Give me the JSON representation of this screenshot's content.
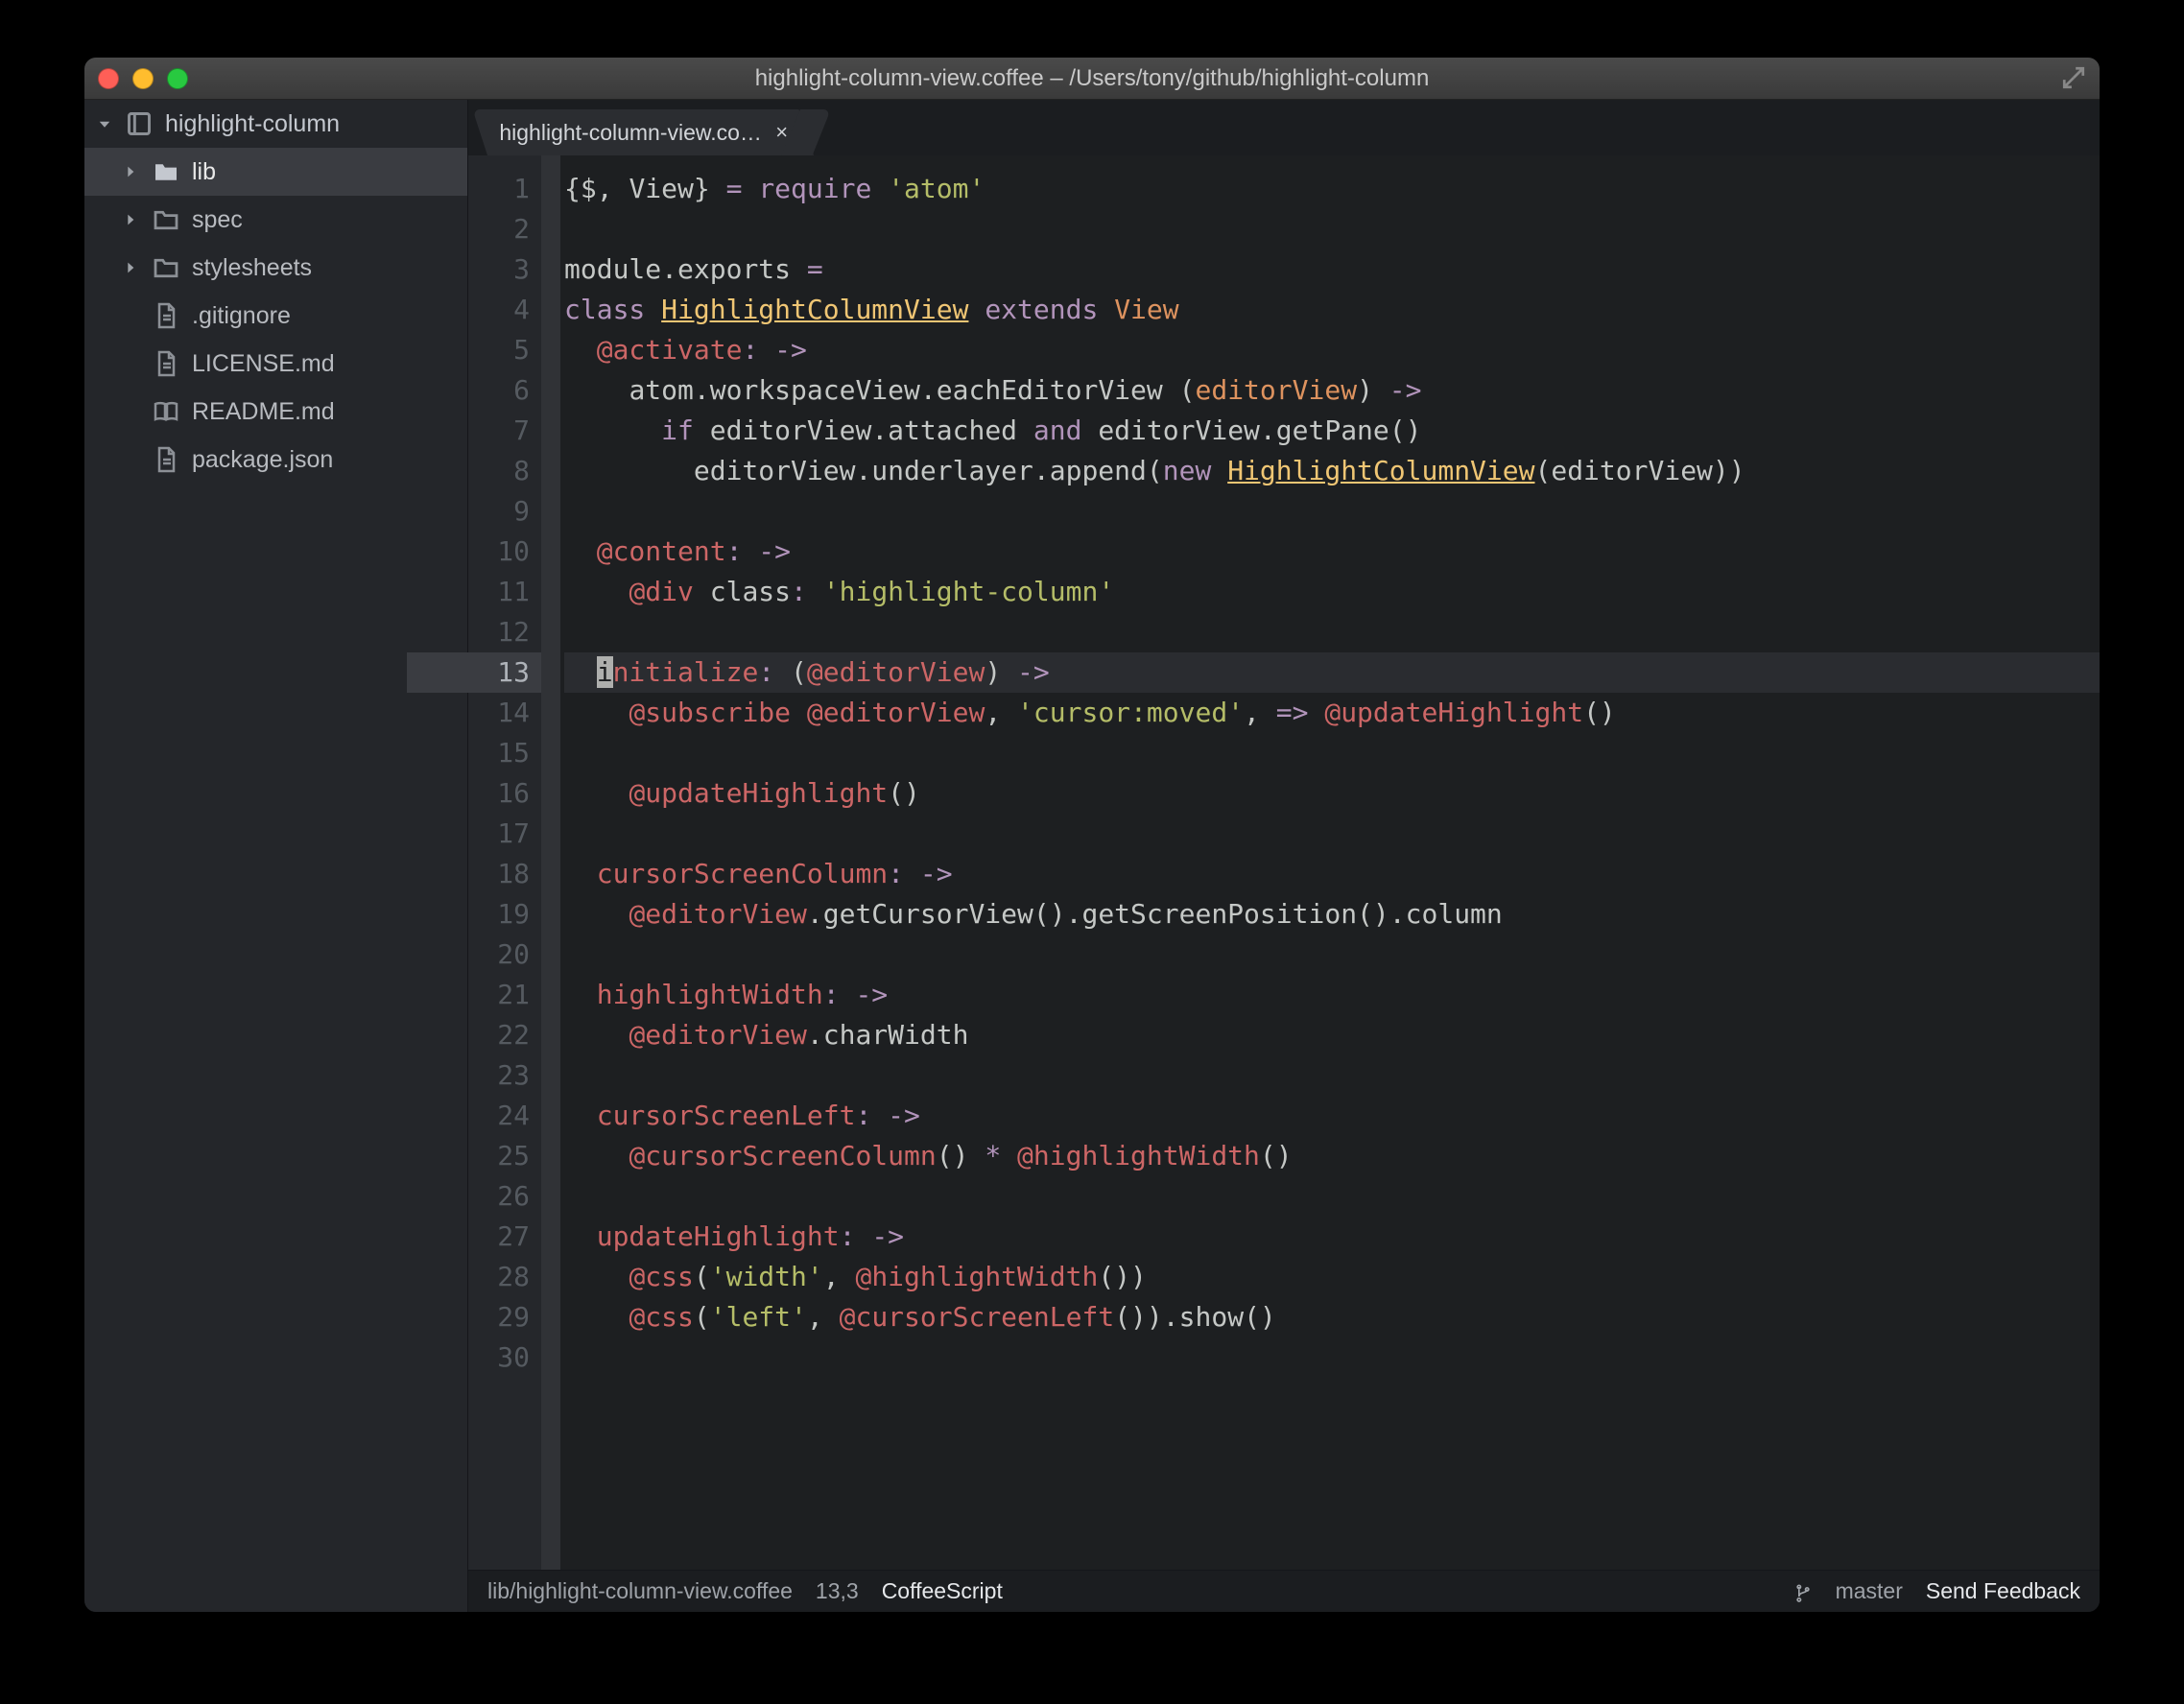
{
  "window": {
    "title": "highlight-column-view.coffee – /Users/tony/github/highlight-column"
  },
  "sidebar": {
    "project": "highlight-column",
    "items": [
      {
        "type": "folder",
        "label": "lib",
        "selected": true
      },
      {
        "type": "folder-outline",
        "label": "spec"
      },
      {
        "type": "folder-outline",
        "label": "stylesheets"
      },
      {
        "type": "file",
        "label": ".gitignore"
      },
      {
        "type": "file",
        "label": "LICENSE.md"
      },
      {
        "type": "book",
        "label": "README.md"
      },
      {
        "type": "file",
        "label": "package.json"
      }
    ]
  },
  "tab": {
    "label": "highlight-column-view.co…"
  },
  "editor": {
    "cursor_line_index": 12,
    "lines": [
      [
        [
          "c-punc",
          "{"
        ],
        [
          "c-ident",
          "$"
        ],
        [
          "c-punc",
          ", "
        ],
        [
          "c-ident",
          "View"
        ],
        [
          "c-punc",
          "} "
        ],
        [
          "c-kw",
          "="
        ],
        [
          "c-punc",
          " "
        ],
        [
          "c-kw",
          "require"
        ],
        [
          "c-punc",
          " "
        ],
        [
          "c-str",
          "'atom'"
        ]
      ],
      [],
      [
        [
          "c-ident",
          "module"
        ],
        [
          "c-punc",
          "."
        ],
        [
          "c-ident",
          "exports"
        ],
        [
          "c-punc",
          " "
        ],
        [
          "c-kw",
          "="
        ]
      ],
      [
        [
          "c-kw",
          "class"
        ],
        [
          "c-punc",
          " "
        ],
        [
          "c-classU",
          "HighlightColumnView"
        ],
        [
          "c-punc",
          " "
        ],
        [
          "c-kw",
          "extends"
        ],
        [
          "c-punc",
          " "
        ],
        [
          "c-base",
          "View"
        ]
      ],
      [
        [
          "c-punc",
          "  "
        ],
        [
          "c-var",
          "@activate"
        ],
        [
          "c-kw",
          ":"
        ],
        [
          "c-punc",
          " "
        ],
        [
          "c-kw",
          "->"
        ]
      ],
      [
        [
          "c-punc",
          "    "
        ],
        [
          "c-ident",
          "atom"
        ],
        [
          "c-punc",
          "."
        ],
        [
          "c-ident",
          "workspaceView"
        ],
        [
          "c-punc",
          "."
        ],
        [
          "c-ident",
          "eachEditorView"
        ],
        [
          "c-punc",
          " "
        ],
        [
          "c-punc",
          "("
        ],
        [
          "c-base",
          "editorView"
        ],
        [
          "c-punc",
          ")"
        ],
        [
          "c-punc",
          " "
        ],
        [
          "c-kw",
          "->"
        ]
      ],
      [
        [
          "c-punc",
          "      "
        ],
        [
          "c-kw",
          "if"
        ],
        [
          "c-punc",
          " "
        ],
        [
          "c-ident",
          "editorView"
        ],
        [
          "c-punc",
          "."
        ],
        [
          "c-ident",
          "attached"
        ],
        [
          "c-punc",
          " "
        ],
        [
          "c-kw",
          "and"
        ],
        [
          "c-punc",
          " "
        ],
        [
          "c-ident",
          "editorView"
        ],
        [
          "c-punc",
          "."
        ],
        [
          "c-ident",
          "getPane"
        ],
        [
          "c-punc",
          "()"
        ]
      ],
      [
        [
          "c-punc",
          "        "
        ],
        [
          "c-ident",
          "editorView"
        ],
        [
          "c-punc",
          "."
        ],
        [
          "c-ident",
          "underlayer"
        ],
        [
          "c-punc",
          "."
        ],
        [
          "c-ident",
          "append"
        ],
        [
          "c-punc",
          "("
        ],
        [
          "c-kw",
          "new"
        ],
        [
          "c-punc",
          " "
        ],
        [
          "c-classU",
          "HighlightColumnView"
        ],
        [
          "c-punc",
          "("
        ],
        [
          "c-ident",
          "editorView"
        ],
        [
          "c-punc",
          "))"
        ]
      ],
      [],
      [
        [
          "c-punc",
          "  "
        ],
        [
          "c-var",
          "@content"
        ],
        [
          "c-kw",
          ":"
        ],
        [
          "c-punc",
          " "
        ],
        [
          "c-kw",
          "->"
        ]
      ],
      [
        [
          "c-punc",
          "    "
        ],
        [
          "c-var",
          "@div"
        ],
        [
          "c-punc",
          " "
        ],
        [
          "c-attrL",
          "class"
        ],
        [
          "c-kw",
          ":"
        ],
        [
          "c-punc",
          " "
        ],
        [
          "c-str",
          "'highlight-column'"
        ]
      ],
      [],
      [
        [
          "c-punc",
          "  "
        ],
        [
          "c-cursor",
          "i"
        ],
        [
          "c-attr",
          "nitialize"
        ],
        [
          "c-kw",
          ":"
        ],
        [
          "c-punc",
          " "
        ],
        [
          "c-punc",
          "("
        ],
        [
          "c-var",
          "@editorView"
        ],
        [
          "c-punc",
          ")"
        ],
        [
          "c-punc",
          " "
        ],
        [
          "c-kw",
          "->"
        ]
      ],
      [
        [
          "c-punc",
          "    "
        ],
        [
          "c-var",
          "@subscribe"
        ],
        [
          "c-punc",
          " "
        ],
        [
          "c-var",
          "@editorView"
        ],
        [
          "c-punc",
          ", "
        ],
        [
          "c-str",
          "'cursor:moved'"
        ],
        [
          "c-punc",
          ", "
        ],
        [
          "c-kw",
          "=>"
        ],
        [
          "c-punc",
          " "
        ],
        [
          "c-var",
          "@updateHighlight"
        ],
        [
          "c-punc",
          "()"
        ]
      ],
      [],
      [
        [
          "c-punc",
          "    "
        ],
        [
          "c-var",
          "@updateHighlight"
        ],
        [
          "c-punc",
          "()"
        ]
      ],
      [],
      [
        [
          "c-punc",
          "  "
        ],
        [
          "c-attr",
          "cursorScreenColumn"
        ],
        [
          "c-kw",
          ":"
        ],
        [
          "c-punc",
          " "
        ],
        [
          "c-kw",
          "->"
        ]
      ],
      [
        [
          "c-punc",
          "    "
        ],
        [
          "c-var",
          "@editorView"
        ],
        [
          "c-punc",
          "."
        ],
        [
          "c-ident",
          "getCursorView"
        ],
        [
          "c-punc",
          "()."
        ],
        [
          "c-ident",
          "getScreenPosition"
        ],
        [
          "c-punc",
          "()."
        ],
        [
          "c-ident",
          "column"
        ]
      ],
      [],
      [
        [
          "c-punc",
          "  "
        ],
        [
          "c-attr",
          "highlightWidth"
        ],
        [
          "c-kw",
          ":"
        ],
        [
          "c-punc",
          " "
        ],
        [
          "c-kw",
          "->"
        ]
      ],
      [
        [
          "c-punc",
          "    "
        ],
        [
          "c-var",
          "@editorView"
        ],
        [
          "c-punc",
          "."
        ],
        [
          "c-ident",
          "charWidth"
        ]
      ],
      [],
      [
        [
          "c-punc",
          "  "
        ],
        [
          "c-attr",
          "cursorScreenLeft"
        ],
        [
          "c-kw",
          ":"
        ],
        [
          "c-punc",
          " "
        ],
        [
          "c-kw",
          "->"
        ]
      ],
      [
        [
          "c-punc",
          "    "
        ],
        [
          "c-var",
          "@cursorScreenColumn"
        ],
        [
          "c-punc",
          "() "
        ],
        [
          "c-kw",
          "*"
        ],
        [
          "c-punc",
          " "
        ],
        [
          "c-var",
          "@highlightWidth"
        ],
        [
          "c-punc",
          "()"
        ]
      ],
      [],
      [
        [
          "c-punc",
          "  "
        ],
        [
          "c-attr",
          "updateHighlight"
        ],
        [
          "c-kw",
          ":"
        ],
        [
          "c-punc",
          " "
        ],
        [
          "c-kw",
          "->"
        ]
      ],
      [
        [
          "c-punc",
          "    "
        ],
        [
          "c-var",
          "@css"
        ],
        [
          "c-punc",
          "("
        ],
        [
          "c-str",
          "'width'"
        ],
        [
          "c-punc",
          ", "
        ],
        [
          "c-var",
          "@highlightWidth"
        ],
        [
          "c-punc",
          "())"
        ]
      ],
      [
        [
          "c-punc",
          "    "
        ],
        [
          "c-var",
          "@css"
        ],
        [
          "c-punc",
          "("
        ],
        [
          "c-str",
          "'left'"
        ],
        [
          "c-punc",
          ", "
        ],
        [
          "c-var",
          "@cursorScreenLeft"
        ],
        [
          "c-punc",
          "())."
        ],
        [
          "c-ident",
          "show"
        ],
        [
          "c-punc",
          "()"
        ]
      ],
      []
    ]
  },
  "status": {
    "path": "lib/highlight-column-view.coffee",
    "position": "13,3",
    "language": "CoffeeScript",
    "branch": "master",
    "feedback": "Send Feedback"
  }
}
